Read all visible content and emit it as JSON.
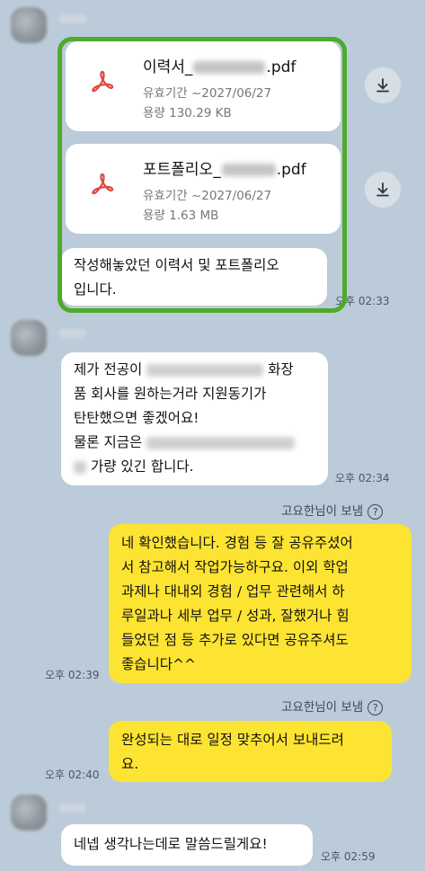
{
  "messages": {
    "file1": {
      "name_prefix": "이력서_",
      "name_suffix": ".pdf",
      "expiry": "유효기간 ~2027/06/27",
      "size": "용량 130.29 KB"
    },
    "file2": {
      "name_prefix": "포트폴리오_",
      "name_suffix": ".pdf",
      "expiry": "유효기간 ~2027/06/27",
      "size": "용량 1.63 MB"
    },
    "msg1": {
      "lines": [
        "작성해놓았던 이력서 및 포트폴리오",
        "입니다."
      ],
      "time": "오후 02:33"
    },
    "msg2": {
      "line1_a": "제가 전공이",
      "line1_b": "화장",
      "line2": "품 회사를 원하는거라 지원동기가",
      "line3": "탄탄했으면 좋겠어요!",
      "line4_a": "물론 지금은",
      "line5_b": "가량 있긴 합니다.",
      "time": "오후 02:34"
    },
    "reply1": {
      "sent_by": "고요한님이 보냄",
      "lines": [
        "네 확인했습니다. 경험 등 잘 공유주셨어",
        "서 참고해서 작업가능하구요. 이외 학업",
        "과제나 대내외 경험 / 업무 관련해서 하",
        "루일과나 세부 업무 / 성과, 잘했거나 힘",
        "들었던 점 등 추가로 있다면 공유주셔도",
        "좋습니다^^"
      ],
      "time": "오후 02:39"
    },
    "reply2": {
      "sent_by": "고요한님이 보냄",
      "lines": [
        "완성되는 대로 일정 맞추어서 보내드려",
        "요."
      ],
      "time": "오후 02:40"
    },
    "msg3": {
      "text": "네넵 생각나는데로 말씀드릴게요!",
      "time": "오후 02:59"
    }
  },
  "colors": {
    "background": "#bccbd9",
    "my_bubble": "#fde432",
    "highlight_border": "#4faa2b",
    "pdf_icon": "#e0463c"
  }
}
